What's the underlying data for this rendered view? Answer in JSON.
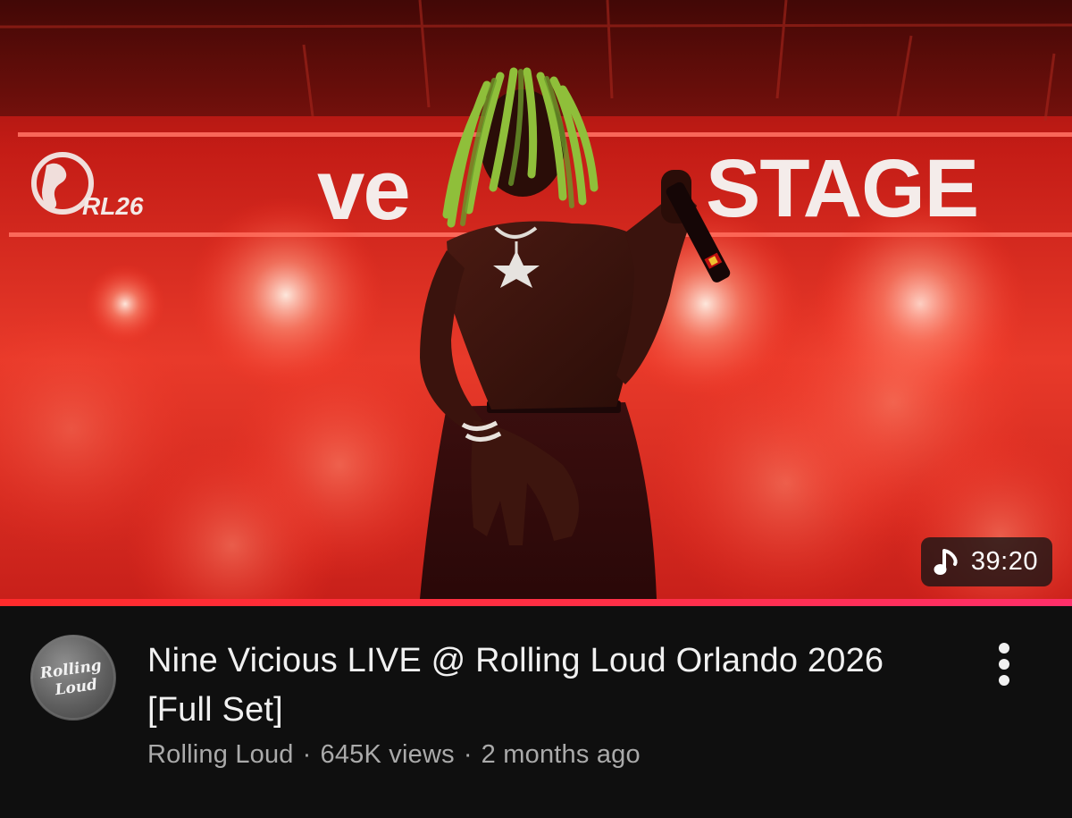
{
  "video": {
    "duration": "39:20",
    "watch_progress": 1.0,
    "badge_icon": "music-note-icon",
    "thumbnail": {
      "stage_sign": "verizon STAGE",
      "stage_sign_partial": "ve",
      "stage_sign_word": "STAGE",
      "festival_logo": "RL26"
    },
    "title": "Nine Vicious LIVE @ Rolling Loud Orlando 2026 [Full Set]",
    "channel": "Rolling Loud",
    "views": "645K views",
    "age": "2 months ago",
    "separator": "·",
    "avatar_text_line1": "Rolling",
    "avatar_text_line2": "Loud",
    "menu_icon": "more-vertical-icon"
  },
  "colors": {
    "background": "#0f0f0f",
    "title": "#f1f1f1",
    "meta": "#aaaaaa",
    "progress": "#ff2b2b",
    "stage_red": "#e3261f"
  }
}
